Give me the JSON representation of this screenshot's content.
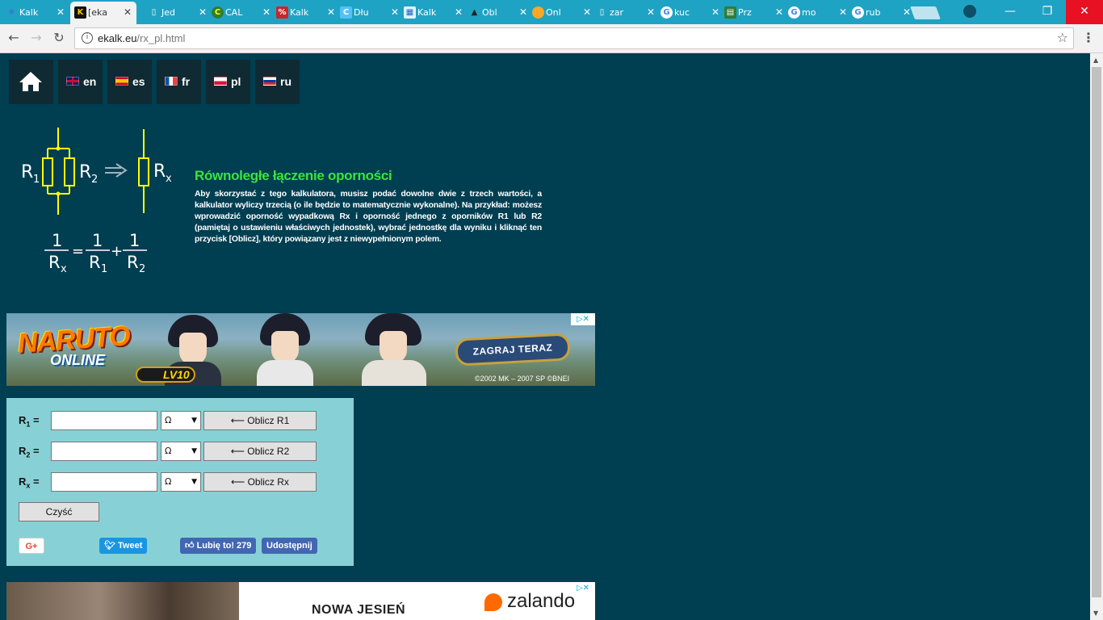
{
  "browser": {
    "tabs": [
      {
        "title": "Kalk",
        "active": false,
        "favicon": "ekalk-icon",
        "color": "#3a7bd5"
      },
      {
        "title": "[eka",
        "active": true,
        "favicon": "k-icon",
        "color": "#f5c400"
      },
      {
        "title": "Jed",
        "active": false,
        "favicon": "doc-icon",
        "color": "#ffffff"
      },
      {
        "title": "CAL",
        "active": false,
        "favicon": "c-icon",
        "color": "#2e7d32"
      },
      {
        "title": "Kalk",
        "active": false,
        "favicon": "percent-icon",
        "color": "#c62828"
      },
      {
        "title": "Dłu",
        "active": false,
        "favicon": "c-icon",
        "color": "#4fc3f7"
      },
      {
        "title": "Kalk",
        "active": false,
        "favicon": "calc-icon",
        "color": "#1565c0"
      },
      {
        "title": "Obl",
        "active": false,
        "favicon": "cap-icon",
        "color": "#333333"
      },
      {
        "title": "Onl",
        "active": false,
        "favicon": "coin-icon",
        "color": "#f9a825"
      },
      {
        "title": "zar",
        "active": false,
        "favicon": "doc-icon",
        "color": "#ffffff"
      },
      {
        "title": "kuc",
        "active": false,
        "favicon": "google-icon",
        "color": "#4285f4"
      },
      {
        "title": "Prz",
        "active": false,
        "favicon": "sheet-icon",
        "color": "#2e7d32"
      },
      {
        "title": "mo",
        "active": false,
        "favicon": "google-icon",
        "color": "#4285f4"
      },
      {
        "title": "rub",
        "active": false,
        "favicon": "google-icon",
        "color": "#4285f4"
      }
    ],
    "url_host": "ekalk.eu",
    "url_path": "/rx_pl.html"
  },
  "nav": {
    "langs": [
      {
        "code": "en",
        "flag": "uk-flag-icon"
      },
      {
        "code": "es",
        "flag": "spain-flag-icon"
      },
      {
        "code": "fr",
        "flag": "france-flag-icon"
      },
      {
        "code": "pl",
        "flag": "poland-flag-icon"
      },
      {
        "code": "ru",
        "flag": "russia-flag-icon"
      }
    ]
  },
  "diagram": {
    "r1": "R",
    "r1_sub": "1",
    "r2": "R",
    "r2_sub": "2",
    "rx": "R",
    "rx_sub": "x",
    "one": "1"
  },
  "content": {
    "title": "Równoległe łączenie oporności",
    "description": "Aby skorzystać z tego kalkulatora, musisz podać dowolne dwie z trzech wartości, a kalkulator wyliczy trzecią (o ile będzie to matematycznie wykonalne). Na przykład: możesz wprowadzić oporność wypadkową Rx i oporność jednego z oporników R1 lub R2 (pamiętaj o ustawieniu właściwych jednostek), wybrać jednostkę dla wyniku i kliknąć ten przycisk [Oblicz], który powiązany jest z niewypełnionym polem."
  },
  "ad1": {
    "logo": "NARUTO",
    "logo_sub": "ONLINE",
    "level": "LV10",
    "cta": "ZAGRAJ TERAZ",
    "copyright": "©2002 MK – 2007 SP    ©BNEI"
  },
  "calculator": {
    "rows": [
      {
        "label": "R",
        "sub": "1",
        "eq": " =",
        "value": "",
        "unit": "Ω",
        "button": "⟵ Oblicz R1"
      },
      {
        "label": "R",
        "sub": "2",
        "eq": " =",
        "value": "",
        "unit": "Ω",
        "button": "⟵ Oblicz R2"
      },
      {
        "label": "R",
        "sub": "x",
        "eq": " =",
        "value": "",
        "unit": "Ω",
        "button": "⟵ Oblicz Rx"
      }
    ],
    "clear": "Czyść",
    "gplus": "G+",
    "tweet": "Tweet",
    "like": "Lubię to! 279",
    "share": "Udostępnij"
  },
  "ad2": {
    "headline": "NOWA JESIEŃ",
    "brand": "zalando"
  },
  "colors": {
    "page_bg": "#003e51",
    "title_green": "#39e639",
    "calc_bg": "#87d1d6",
    "tab_bar": "#1fa3c4"
  }
}
